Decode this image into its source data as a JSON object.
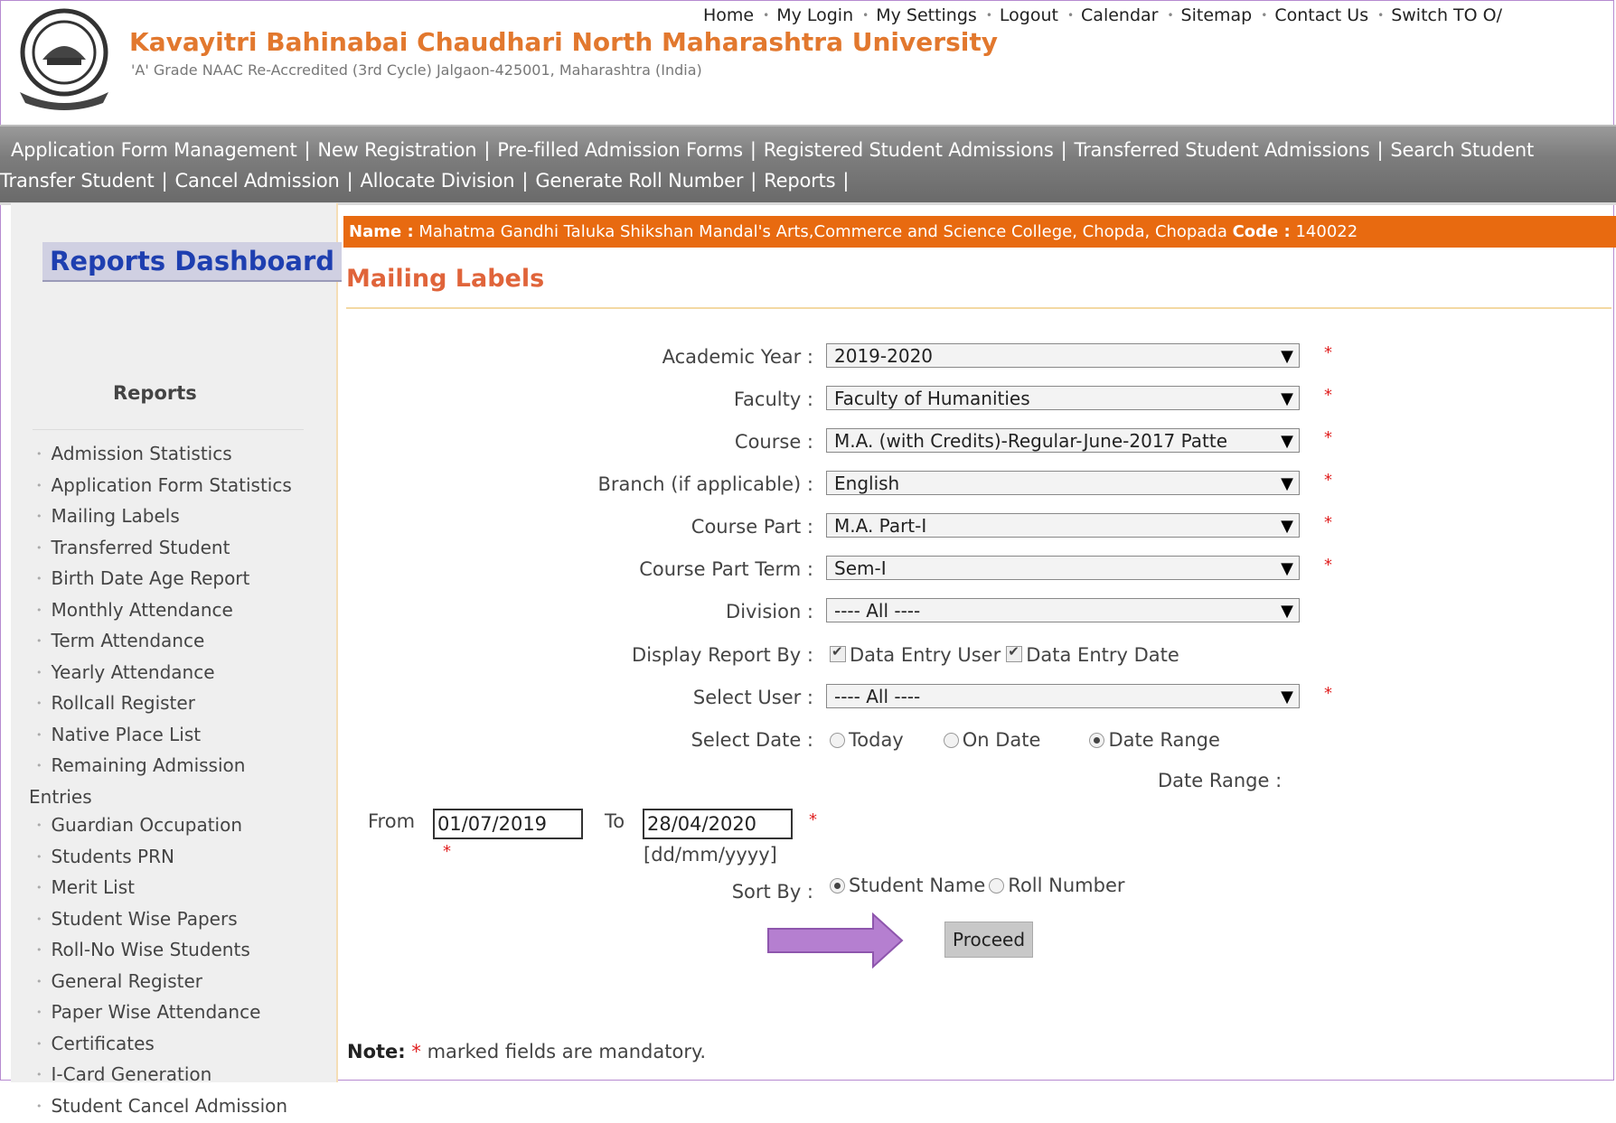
{
  "header": {
    "university_name": "Kavayitri Bahinabai Chaudhari North Maharashtra University",
    "university_sub": "'A' Grade NAAC Re-Accredited (3rd Cycle) Jalgaon-425001, Maharashtra (India)",
    "top_links": [
      "Home",
      "My Login",
      "My Settings",
      "Logout",
      "Calendar",
      "Sitemap",
      "Contact Us",
      "Switch TO O/"
    ]
  },
  "nav": {
    "row1": [
      "Application Form Management",
      "New Registration",
      "Pre-filled Admission Forms",
      "Registered Student Admissions",
      "Transferred Student Admissions",
      "Search Student"
    ],
    "row2": [
      "Transfer Student",
      "Cancel Admission",
      "Allocate Division",
      "Generate Roll Number",
      "Reports"
    ]
  },
  "sidebar": {
    "dashboard_title": "Reports Dashboard",
    "reports_heading": "Reports",
    "items": [
      "Admission Statistics",
      "Application Form Statistics",
      "Mailing Labels",
      "Transferred Student",
      "Birth Date Age Report",
      "Monthly Attendance",
      "Term Attendance",
      "Yearly Attendance",
      "Rollcall Register",
      "Native Place List",
      "Remaining Admission",
      "Entries",
      "Guardian Occupation",
      "Students PRN",
      "Merit List",
      "Student Wise Papers",
      "Roll-No Wise Students",
      "General Register",
      "Paper Wise Attendance",
      "Certificates",
      "I-Card Generation",
      "Student Cancel Admission"
    ]
  },
  "namebar": {
    "name_label": "Name :",
    "name_value": "Mahatma Gandhi Taluka Shikshan Mandal's Arts,Commerce and Science College, Chopda, Chopada",
    "code_label": "Code :",
    "code_value": "140022"
  },
  "page_title": "Mailing Labels",
  "form": {
    "academic_year": {
      "label": "Academic Year :",
      "value": "2019-2020"
    },
    "faculty": {
      "label": "Faculty :",
      "value": "Faculty of Humanities"
    },
    "course": {
      "label": "Course :",
      "value": "M.A. (with Credits)-Regular-June-2017 Patte"
    },
    "branch": {
      "label": "Branch (if applicable) :",
      "value": "English"
    },
    "course_part": {
      "label": "Course Part :",
      "value": "M.A. Part-I"
    },
    "course_part_term": {
      "label": "Course Part Term :",
      "value": "Sem-I"
    },
    "division": {
      "label": "Division :",
      "value": "---- All ----"
    },
    "display_report_by": {
      "label": "Display Report By :",
      "opt1": "Data Entry User",
      "opt2": "Data Entry Date"
    },
    "select_user": {
      "label": "Select User :",
      "value": "---- All ----"
    },
    "select_date": {
      "label": "Select Date :",
      "opt1": "Today",
      "opt2": "On Date",
      "opt3": "Date Range",
      "selected": "Date Range"
    },
    "date_range_label": "Date Range :",
    "from_label": "From",
    "from_value": "01/07/2019",
    "to_label": "To",
    "to_value": "28/04/2020",
    "date_format_hint": "[dd/mm/yyyy]",
    "sort_by": {
      "label": "Sort By :",
      "opt1": "Student Name",
      "opt2": "Roll Number",
      "selected": "Student Name"
    },
    "required_mark": "*",
    "proceed_label": "Proceed"
  },
  "note": {
    "label": "Note:",
    "star": "*",
    "text": "marked fields are mandatory."
  },
  "colors": {
    "accent_orange": "#e86a10",
    "title_red": "#e0643a",
    "link_blue": "#1e3fb0",
    "arrow_purple": "#b57fd0"
  }
}
